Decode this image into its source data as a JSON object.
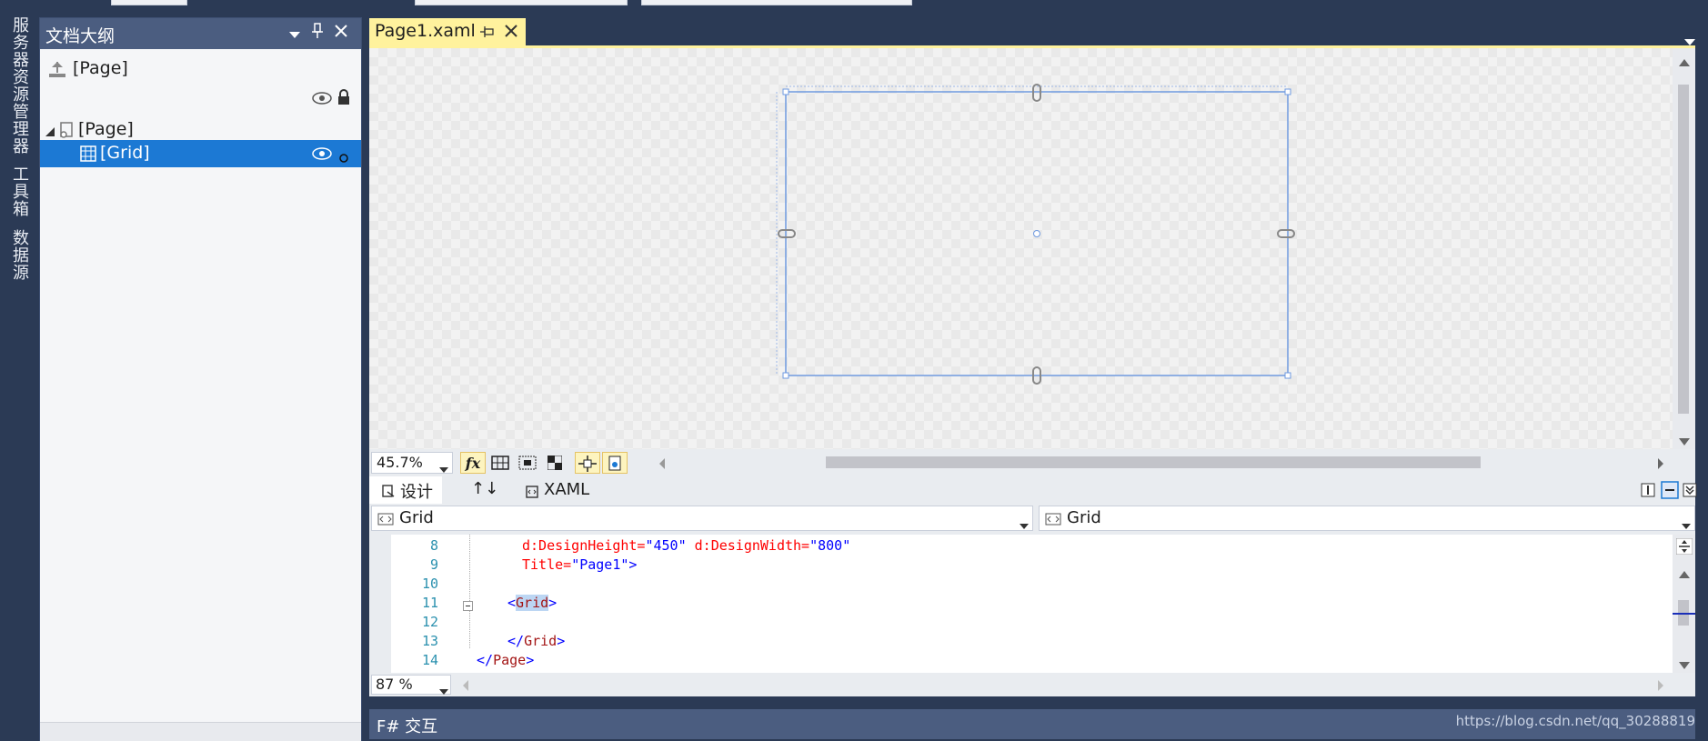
{
  "vertical_tabs": [
    "服务器资源管理器",
    "工具箱",
    "数据源"
  ],
  "outline_panel": {
    "title": "文档大纲",
    "root_label": "[Page]",
    "tree": [
      {
        "label": "[Page]",
        "expanded": true
      },
      {
        "label": "[Grid]",
        "selected": true
      }
    ]
  },
  "document_tab": {
    "label": "Page1.xaml"
  },
  "designer": {
    "zoom": "45.7%"
  },
  "split_tabs": {
    "design": "设计",
    "swap_icon": "↑↓",
    "xaml": "XAML"
  },
  "dropdowns": {
    "left": "Grid",
    "right": "Grid"
  },
  "code": {
    "zoom": "87 %",
    "lines": [
      {
        "num": "8"
      },
      {
        "num": "9"
      },
      {
        "num": "10"
      },
      {
        "num": "11"
      },
      {
        "num": "12"
      },
      {
        "num": "13"
      },
      {
        "num": "14"
      }
    ],
    "tokens": {
      "l8_a": "d:DesignHeight=",
      "l8_v": "\"450\"",
      "l8_b": " d:DesignWidth=",
      "l8_w": "\"800\"",
      "l9_a": "Title=",
      "l9_v": "\"Page1\"",
      "l9_end": ">",
      "l11_open": "<",
      "l11_tag": "Grid",
      "l11_close": ">",
      "l13_open": "</",
      "l13_tag": "Grid",
      "l13_close": ">",
      "l14_open": "</",
      "l14_tag": "Page",
      "l14_close": ">"
    }
  },
  "bottom_panel": {
    "title": "F# 交互"
  },
  "watermark": "https://blog.csdn.net/qq_30288819",
  "colors": {
    "accent": "#1c79d4",
    "header": "#4b5d80",
    "tab_active": "#fff29d",
    "frame": "#2b3a55"
  }
}
